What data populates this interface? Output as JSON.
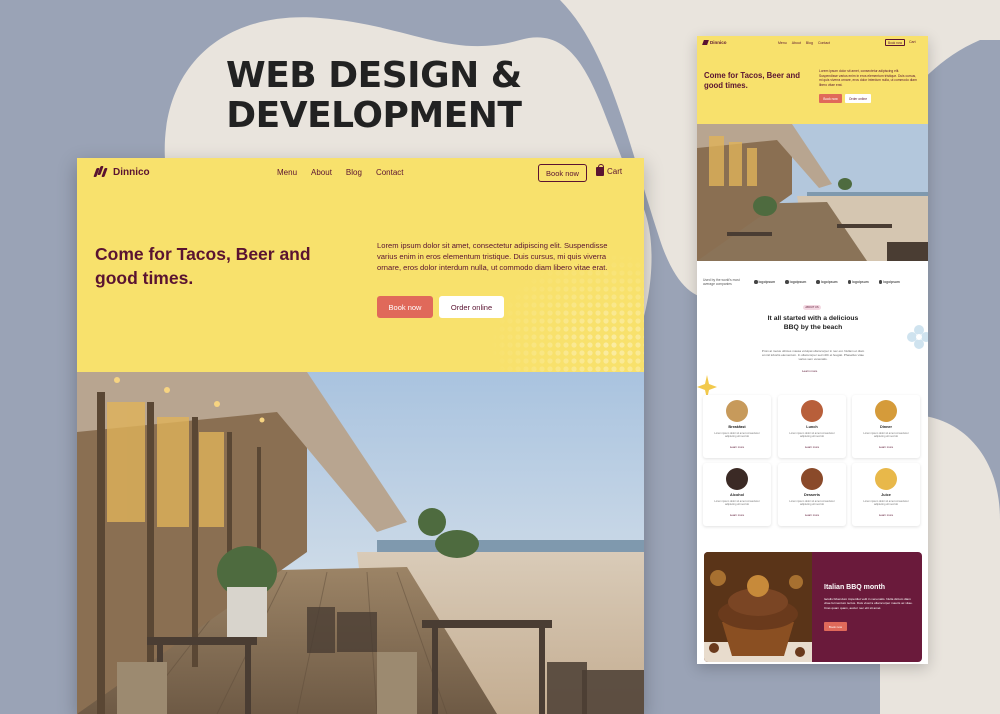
{
  "colors": {
    "background": "#9aa3b6",
    "blob": "#e9e4dd",
    "hero_yellow": "#f8e16c",
    "brand_maroon": "#5a1331",
    "accent_coral": "#e0695a"
  },
  "headline": {
    "line1": "WEB DESIGN &",
    "line2": "DEVELOPMENT"
  },
  "desktop": {
    "brand": "Dinnico",
    "nav": [
      "Menu",
      "About",
      "Blog",
      "Contact"
    ],
    "book_now": "Book now",
    "cart": "Cart",
    "hero_title": "Come for Tacos, Beer and good times.",
    "hero_text": "Lorem ipsum dolor sit amet, consectetur adipiscing elit. Suspendisse varius enim in eros elementum tristique. Duis cursus, mi quis viverra ornare, eros dolor interdum nulla, ut commodo diam libero vitae erat.",
    "btn_book": "Book now",
    "btn_order": "Order online"
  },
  "mobile": {
    "brand": "Dinnico",
    "nav": [
      "Menu",
      "About",
      "Blog",
      "Contact"
    ],
    "book_now": "Book now",
    "cart": "Cart",
    "hero_title": "Come for Tacos, Beer and good times.",
    "hero_text": "Lorem ipsum dolor sit amet, consectetur adipiscing elit. Suspendisse varius enim in eros elementum tristique. Duis cursus, mi quis viverra ornare, eros dolor interdum nulla, ut commodo diam libero vitae erat.",
    "btn_book": "Book now",
    "btn_order": "Order online",
    "logos_text": "Used by the world's most average companies",
    "logo_names": [
      "logoipsum",
      "logoipsum",
      "logoipsum",
      "logoipsum",
      "logoipsum"
    ],
    "story_tag": "ABOUT US",
    "story_title": "It all started with a delicious BBQ by the beach",
    "story_text": "Proin at metus ultrices massa volutpat ullamcorper in nec est. Nullam et diam at nisl lobortis elementum. In ullamcorper sed nibh et feugiat. Phasellus vitae varius sem venenatis.",
    "story_link": "Learn more",
    "cards": [
      {
        "name": "Breakfast",
        "desc": "Lorem ipsum dolor sit amet consectetur adipiscing elit sed do",
        "link": "Learn more",
        "color": "#c79a5b"
      },
      {
        "name": "Lunch",
        "desc": "Lorem ipsum dolor sit amet consectetur adipiscing elit sed do",
        "link": "Learn more",
        "color": "#b85f3a"
      },
      {
        "name": "Dinner",
        "desc": "Lorem ipsum dolor sit amet consectetur adipiscing elit sed do",
        "link": "Learn more",
        "color": "#d59b3a"
      },
      {
        "name": "Alcohol",
        "desc": "Lorem ipsum dolor sit amet consectetur adipiscing elit sed do",
        "link": "Learn more",
        "color": "#3b2a25"
      },
      {
        "name": "Desserts",
        "desc": "Lorem ipsum dolor sit amet consectetur adipiscing elit sed do",
        "link": "Learn more",
        "color": "#8a4a2a"
      },
      {
        "name": "Juice",
        "desc": "Lorem ipsum dolor sit amet consectetur adipiscing elit sed do",
        "link": "Learn more",
        "color": "#e8b84a"
      }
    ],
    "promo_title": "Italian BBQ month",
    "promo_text": "Iaculis bibendum imperdiet velit in venenatis. Nulla dictum diam vitae fermentum lectus. Duis viverra ullamcorper mauris ac vitae. Cras quam quam, auctor nec elit sit amet.",
    "promo_btn": "Book now"
  }
}
